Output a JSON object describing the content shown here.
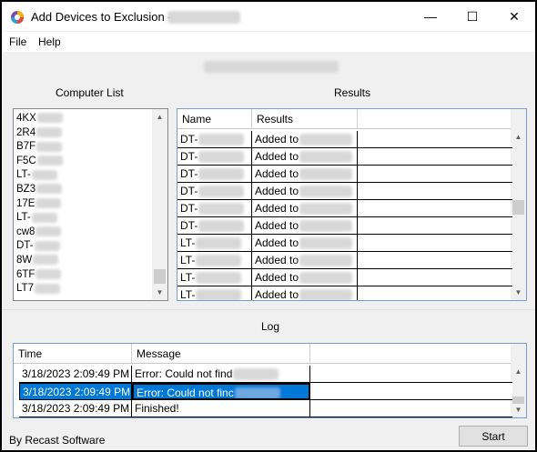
{
  "window": {
    "title": "Add Devices to Exclusion -",
    "minimize_glyph": "—",
    "maximize_glyph": "☐",
    "close_glyph": "✕"
  },
  "menu": {
    "file": "File",
    "help": "Help"
  },
  "computer_list": {
    "label": "Computer List",
    "items": [
      "4KX",
      "2R4",
      "B7F",
      "F5C",
      "LT-",
      "BZ3",
      "17E",
      "LT-",
      "cw8",
      "DT-",
      "8W",
      "6TF",
      "LT7"
    ]
  },
  "results": {
    "label": "Results",
    "columns": [
      "Name",
      "Results"
    ],
    "rows": [
      {
        "name": "DT-",
        "result": "Added to"
      },
      {
        "name": "DT-",
        "result": "Added to"
      },
      {
        "name": "DT-",
        "result": "Added to"
      },
      {
        "name": "DT-",
        "result": "Added to"
      },
      {
        "name": "DT-",
        "result": "Added to"
      },
      {
        "name": "DT-",
        "result": "Added to"
      },
      {
        "name": "LT-",
        "result": "Added to"
      },
      {
        "name": "LT-",
        "result": "Added to"
      },
      {
        "name": "LT-",
        "result": "Added to"
      },
      {
        "name": "LT-",
        "result": "Added to"
      }
    ]
  },
  "log": {
    "label": "Log",
    "columns": [
      "Time",
      "Message"
    ],
    "rows": [
      {
        "time": "3/18/2023 2:09:49 PM",
        "message": "Error: Could not find"
      },
      {
        "time": "3/18/2023 2:09:49 PM",
        "message": "Error: Could not finc"
      },
      {
        "time": "3/18/2023 2:09:49 PM",
        "message": "Finished!"
      }
    ]
  },
  "footer": {
    "credit": "By Recast Software",
    "start_label": "Start"
  },
  "colors": {
    "selection": "#0078d7",
    "grid_border": "#7a9cd3",
    "window_bg": "#f0f0f0"
  }
}
